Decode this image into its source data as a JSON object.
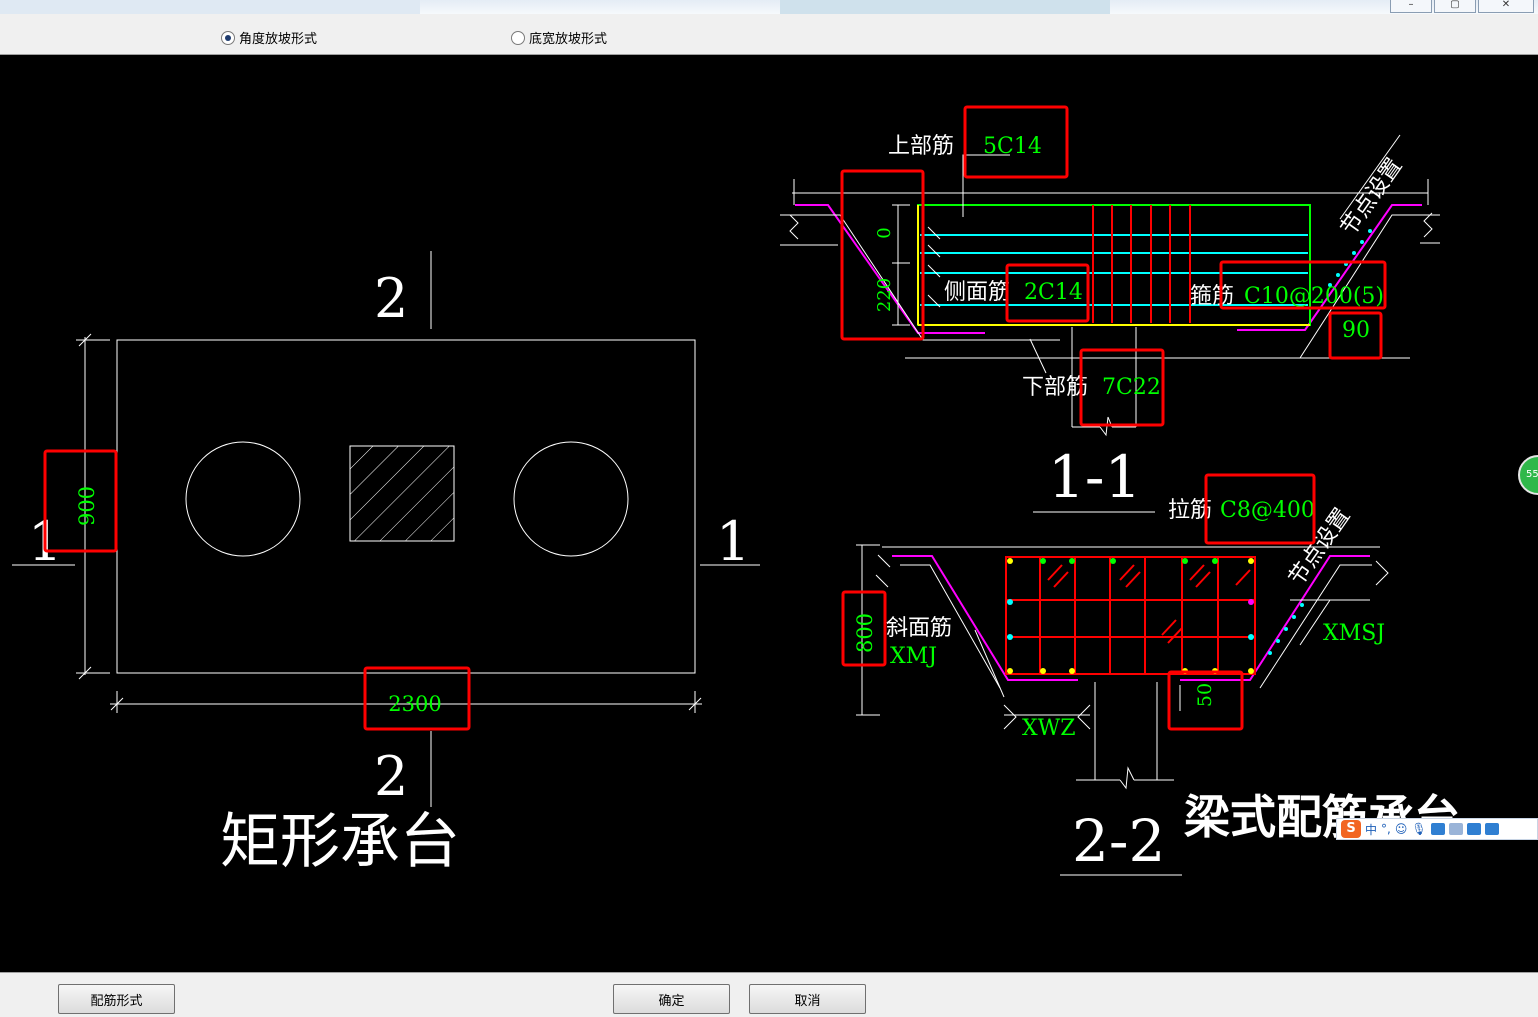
{
  "window": {
    "minimize_icon": "minimize-icon",
    "maximize_icon": "maximize-icon",
    "close_icon": "close-icon"
  },
  "radios": [
    {
      "label": "角度放坡形式",
      "checked": true
    },
    {
      "label": "底宽放坡形式",
      "checked": false
    }
  ],
  "drawing": {
    "plan": {
      "title": "矩形承台",
      "section_marks": {
        "top": "2",
        "bottom": "2",
        "left": "1",
        "right": "1"
      },
      "width_dim": "2300",
      "height_dim": "900"
    },
    "section_1_1": {
      "title": "1-1",
      "top_bar_label": "上部筋",
      "top_bar_value": "5C14",
      "side_bar_label": "侧面筋",
      "side_bar_value": "2C14",
      "stirrup_label": "箍筋",
      "stirrup_value": "C10@200(5)",
      "bottom_bar_label": "下部筋",
      "bottom_bar_value": "7C22",
      "node_label": "节点设置",
      "dim_upper": "0",
      "dim_lower": "220",
      "angle": "90"
    },
    "section_2_2": {
      "title": "2-2",
      "tie_label": "拉筋",
      "tie_value": "C8@400",
      "node_label": "节点设置",
      "slope_bar_label": "斜面筋",
      "slope_bar_value": "XMJ",
      "xmsj": "XMSJ",
      "xwz": "XWZ",
      "height_dim": "800",
      "cover_dim": "50"
    },
    "caption": "梁式配筋承台",
    "colors": {
      "canvas": "#000000",
      "line": "#ffffff",
      "dim_text": "#00ff00",
      "highlight": "#ff0000",
      "slope": "#ff00ff",
      "rebar": "#ff0000",
      "stirrup": "#00ffff",
      "cap_outline": "#00ff00",
      "side_bar": "#ffff00"
    }
  },
  "buttons": {
    "rebar_form": "配筋形式",
    "ok": "确定",
    "cancel": "取消"
  },
  "ime_bar": {
    "logo": "S",
    "mode": "中",
    "punct": "°,"
  },
  "edge_badge": "55"
}
